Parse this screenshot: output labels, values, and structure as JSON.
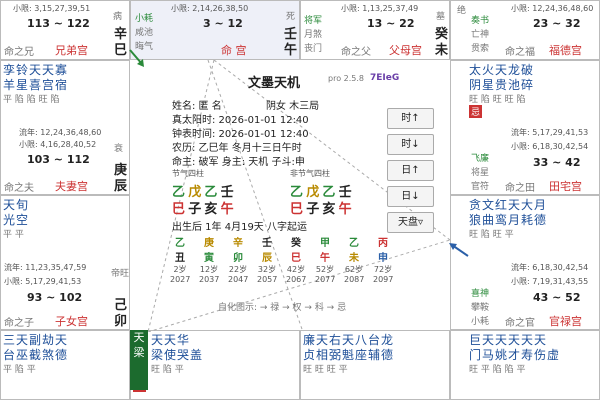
{
  "top": {
    "c1": {
      "xiaoxian": "小限: 3,15,27,39,51",
      "range": "113 ~ 122",
      "stem": "辛",
      "branch": "巳",
      "left": "命之兄",
      "palace": "兄弟宫",
      "side": "病"
    },
    "c2": {
      "xiaoxian": "小限: 2,14,26,38,50",
      "range": "3 ~ 12",
      "stem": "壬",
      "branch": "午",
      "god1": "小耗",
      "god2": "咸池",
      "god3": "晦气",
      "palace": "命 宫",
      "side": "死"
    },
    "c3": {
      "xiaoxian": "小限: 1,13,25,37,49",
      "range": "13 ~ 22",
      "stem": "癸",
      "branch": "未",
      "god1": "将军",
      "god2": "月煞",
      "god3": "丧门",
      "left": "命之父",
      "palace": "父母宫",
      "side": "墓"
    },
    "c4": {
      "xiaoxian": "小限: 12,24,36,48,60",
      "range": "23 ~ 32",
      "god1": "奏书",
      "god2": "亡神",
      "god3": "贯索",
      "left": "命之福",
      "palace": "福德宫",
      "side": "绝"
    }
  },
  "leftcol": {
    "row2": {
      "stars": "孪铃天天寡",
      "stars2": "羊星喜宫宿",
      "state": "平 陷 陷 旺 陷",
      "liunian": "流年: 12,24,36,48,60",
      "xiaoxian": "小限: 4,16,28,40,52",
      "range": "103 ~ 112",
      "stem": "庚",
      "branch": "辰",
      "side": "衰",
      "left": "命之夫",
      "palace": "夫妻宫"
    },
    "row3": {
      "stars": "天旬",
      "stars2": "光空",
      "state": "平 平",
      "liunian": "流年: 11,23,35,47,59",
      "xiaoxian": "小限: 5,17,29,41,53",
      "range": "93 ~ 102",
      "stem": "己",
      "branch": "卯",
      "side": "帝旺",
      "left": "命之子",
      "palace": "子女宫"
    },
    "row4": {
      "stars": "三天副劫天",
      "stars2": "台巫截煞德",
      "state": "平 陷 平"
    }
  },
  "rightcol": {
    "row2": {
      "stars": "太火天龙破",
      "stars2": "阴星贵池碎",
      "state": "旺 陷 旺 旺 陷",
      "badge": "忌",
      "liunian": "流年: 5,17,29,41,53",
      "xiaoxian": "小限: 6,18,30,42,54",
      "range": "33 ~ 42",
      "god1": "飞廉",
      "god2": "将星",
      "god3": "官符",
      "left": "命之田",
      "palace": "田宅宫"
    },
    "row3": {
      "stars": "贪文红天大月",
      "stars2": "狼曲鸾月耗德",
      "state": "旺 陷 旺 平",
      "liunian": "流年: 6,18,30,42,54",
      "xiaoxian": "小限: 7,19,31,43,55",
      "range": "43 ~ 52",
      "god1": "喜神",
      "god2": "攀鞍",
      "god3": "小耗",
      "left": "命之官",
      "palace": "官禄宫"
    },
    "row4": {
      "stars": "巨天天天天天",
      "stars2": "门马姚才寿伤虚",
      "state": "旺 平 陷 陷 平"
    }
  },
  "bottom": {
    "b2": {
      "stars": "天天华",
      "stars2": "梁使哭盖",
      "state": "旺 陷 平",
      "badge": "权",
      "green": "天梁"
    },
    "b3": {
      "stars": "廉天右天八台龙",
      "stars2": "贞相弼魁座辅德",
      "state": "旺 旺 旺 平"
    }
  },
  "center": {
    "app": "文墨天机",
    "ver": "pro 2.5.8",
    "code": "7EIeG",
    "name": "姓名: 匿 名",
    "gender": "阴女 木三局",
    "solar": "真太阳时: 2026-01-01 12:40",
    "clock": "钟表时间: 2026-01-01 12:40",
    "lunar": "农历: 乙巳年 冬月十三日午时",
    "master": "命主: 破军 身主: 天机 子斗:申",
    "jieqi1": "节气四柱",
    "jieqi2": "非节气四柱",
    "p1t": [
      "乙",
      "戊",
      "乙",
      "壬"
    ],
    "p1b": [
      "巳",
      "子",
      "亥",
      "午"
    ],
    "p2t": [
      "乙",
      "戊",
      "乙",
      "壬"
    ],
    "p2b": [
      "巳",
      "子",
      "亥",
      "午"
    ],
    "born": "出生后 1年 4月19天 八字起运",
    "dy": [
      {
        "g": "乙",
        "z": "丑",
        "age": "2岁",
        "yr": "2027"
      },
      {
        "g": "庚",
        "z": "寅",
        "age": "12岁",
        "yr": "2037"
      },
      {
        "g": "辛",
        "z": "卯",
        "age": "22岁",
        "yr": "2047"
      },
      {
        "g": "壬",
        "z": "辰",
        "age": "32岁",
        "yr": "2057"
      },
      {
        "g": "癸",
        "z": "巳",
        "age": "42岁",
        "yr": "2067"
      },
      {
        "g": "甲",
        "z": "午",
        "age": "52岁",
        "yr": "2077"
      },
      {
        "g": "乙",
        "z": "未",
        "age": "62岁",
        "yr": "2087"
      },
      {
        "g": "丙",
        "z": "申",
        "age": "72岁",
        "yr": "2097"
      }
    ],
    "legend": "自化图示: → 禄 → 权 → 科 → 忌"
  },
  "buttons": {
    "b1": "时↑",
    "b2": "时↓",
    "b3": "日↑",
    "b4": "日↓",
    "b5": "天盘▿"
  }
}
